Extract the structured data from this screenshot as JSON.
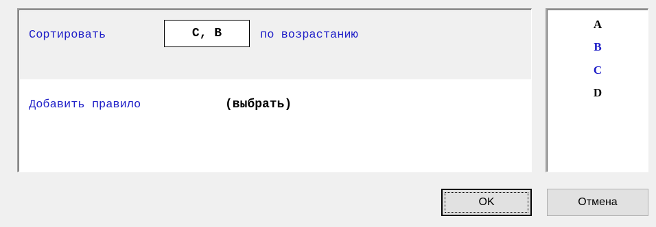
{
  "rules": {
    "sort_label": "Сортировать",
    "sort_columns_value": "C, B",
    "sort_direction": "по возрастанию",
    "add_rule_label": "Добавить правило",
    "add_rule_choose": "(выбрать)"
  },
  "columns": {
    "items": [
      {
        "label": "A",
        "used": false
      },
      {
        "label": "B",
        "used": true
      },
      {
        "label": "C",
        "used": true
      },
      {
        "label": "D",
        "used": false
      }
    ]
  },
  "buttons": {
    "ok_label": "OK",
    "cancel_label": "Отмена"
  },
  "colors": {
    "link_text": "#2020c8",
    "dialog_background": "#f0f0f0"
  }
}
